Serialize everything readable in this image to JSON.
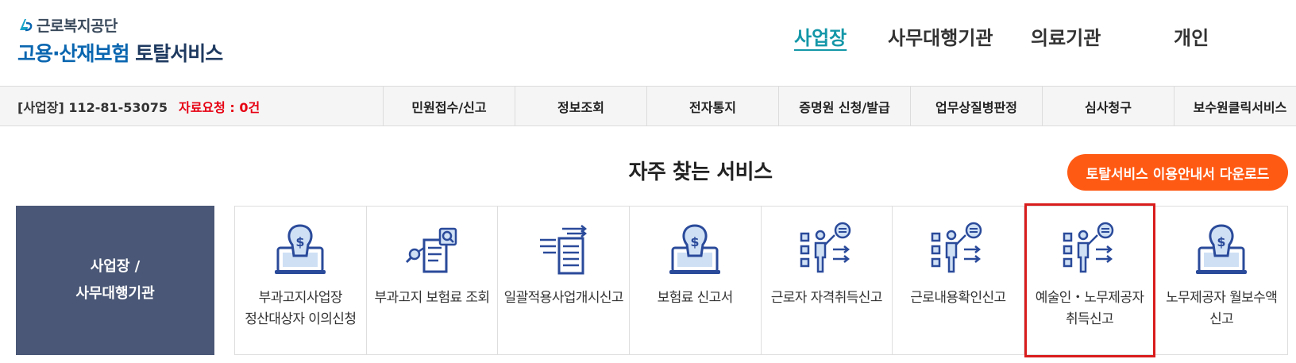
{
  "logo": {
    "org": "근로복지공단",
    "title_blue": "고용·산재보험",
    "title_dark": "토탈서비스"
  },
  "topnav": [
    {
      "label": "사업장",
      "active": true
    },
    {
      "label": "사무대행기관",
      "active": false
    },
    {
      "label": "의료기관",
      "active": false
    },
    {
      "label": "개인",
      "active": false
    }
  ],
  "subbar": {
    "business": "[사업장] 112-81-53075",
    "request": "자료요청 : 0건",
    "menu": [
      "민원접수/신고",
      "정보조회",
      "전자통지",
      "증명원 신청/발급",
      "업무상질병판정",
      "심사청구",
      "보수원클릭서비스"
    ]
  },
  "section": {
    "title": "자주 찾는 서비스",
    "download_label": "토탈서비스 이용안내서 다운로드"
  },
  "category": {
    "line1": "사업장 /",
    "line2": "사무대행기관"
  },
  "cards": [
    {
      "label": "부과고지사업장 정산대상자 이의신청",
      "icon": "money-laptop-icon"
    },
    {
      "label": "부과고지 보험료 조회",
      "icon": "document-search-icon"
    },
    {
      "label": "일괄적용사업개시신고",
      "icon": "document-transfer-icon"
    },
    {
      "label": "보험료 신고서",
      "icon": "money-laptop-icon"
    },
    {
      "label": "근로자 자격취득신고",
      "icon": "presenter-icon"
    },
    {
      "label": "근로내용확인신고",
      "icon": "presenter-icon"
    },
    {
      "label": "예술인・노무제공자 취득신고",
      "icon": "presenter-icon",
      "highlighted": true
    },
    {
      "label": "노무제공자 월보수액 신고",
      "icon": "money-laptop-icon"
    }
  ],
  "colors": {
    "accent_teal": "#1497a8",
    "brand_blue": "#0a66b0",
    "alert_red": "#e60012",
    "download_orange": "#ff5a14",
    "category_bg": "#4a5776",
    "highlight_border": "#d91c1c",
    "icon_blue": "#2a4a9a"
  }
}
